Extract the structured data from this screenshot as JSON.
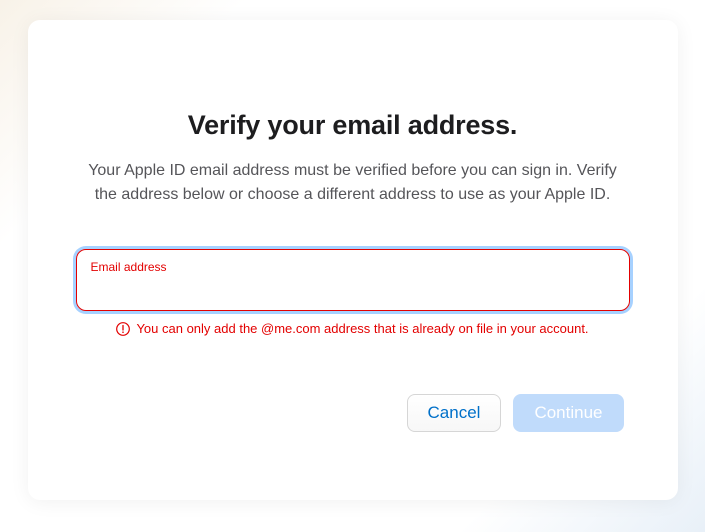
{
  "modal": {
    "title": "Verify your email address.",
    "description": "Your Apple ID email address must be verified before you can sign in. Verify the address below or choose a different address to use as your Apple ID.",
    "input": {
      "label": "Email address",
      "value": ""
    },
    "error": {
      "message": "You can only add the @me.com address that is already on file in your account."
    },
    "buttons": {
      "cancel": "Cancel",
      "continue": "Continue"
    }
  }
}
